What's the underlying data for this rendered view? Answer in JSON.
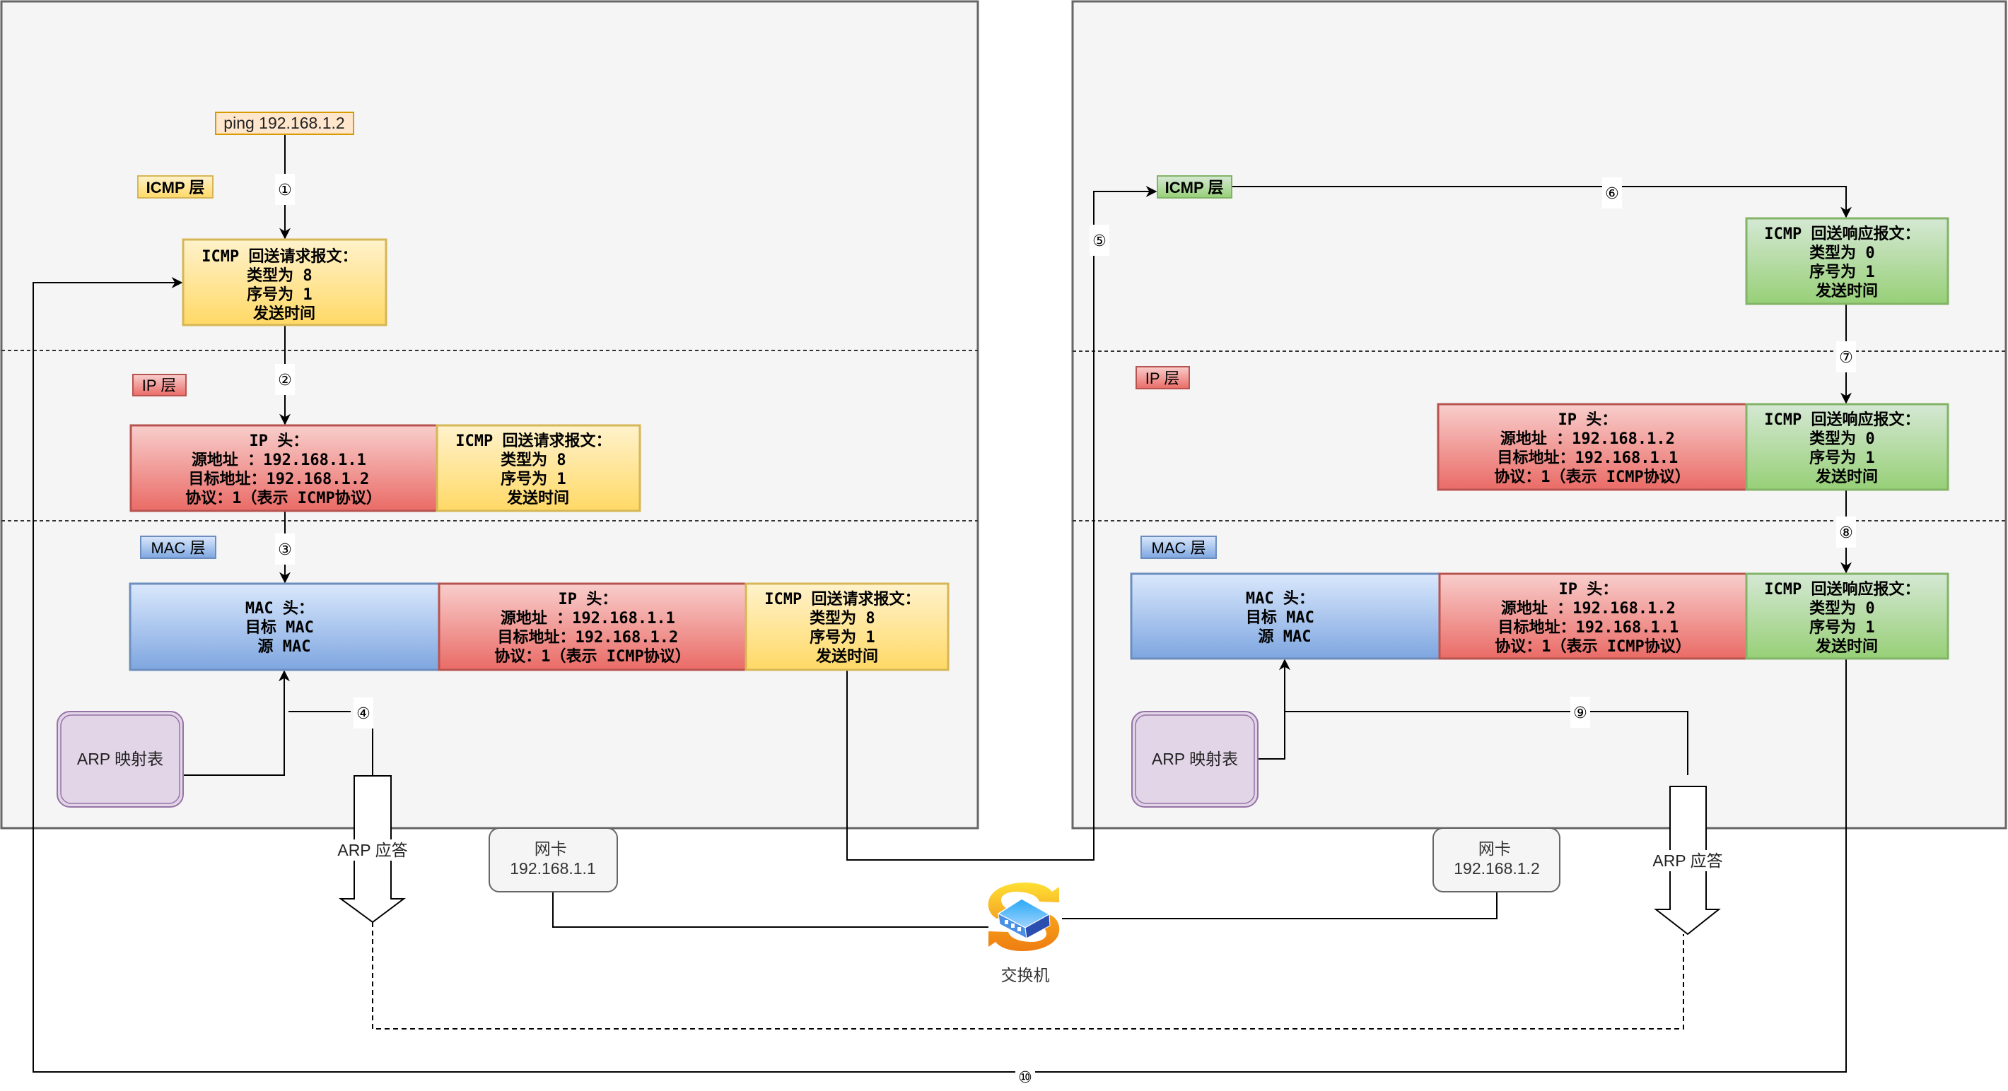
{
  "colors": {
    "icmp_request_fill_top": "#fff2cc",
    "icmp_request_fill_bottom": "#ffd966",
    "icmp_request_stroke": "#d6b656",
    "icmp_reply_fill_top": "#d5e8d4",
    "icmp_reply_fill_bottom": "#97d077",
    "icmp_reply_stroke": "#82b366",
    "ip_fill_top": "#f8cecc",
    "ip_fill_bottom": "#ea6b66",
    "ip_stroke": "#b85450",
    "mac_fill_top": "#dae8fc",
    "mac_fill_bottom": "#7ea6e0",
    "mac_stroke": "#6c8ebf",
    "arp_fill": "#e1d5e7",
    "arp_stroke": "#9673a6",
    "ping_fill": "#ffe6cc",
    "ping_stroke": "#d79b00"
  },
  "sender": {
    "command": "ping 192.168.1.2",
    "layers": {
      "icmp": "ICMP 层",
      "ip": "IP 层",
      "mac": "MAC 层"
    },
    "icmp_message": [
      "ICMP 回送请求报文：",
      "类型为 8",
      "序号为 1",
      "发送时间"
    ],
    "ip_header": [
      "IP 头：",
      "源地址  ：192.168.1.1",
      "目标地址：192.168.1.2",
      "协议：1（表示 ICMP协议）"
    ],
    "mac_header": [
      "MAC 头：",
      "目标 MAC",
      "源 MAC"
    ],
    "arp_table": "ARP 映射表",
    "arp_reply": "ARP 应答",
    "nic": [
      "网卡",
      "192.168.1.1"
    ]
  },
  "receiver": {
    "layers": {
      "icmp": "ICMP 层",
      "ip": "IP 层",
      "mac": "MAC 层"
    },
    "icmp_message": [
      "ICMP 回送响应报文：",
      "类型为 0",
      "序号为 1",
      "发送时间"
    ],
    "ip_header": [
      "IP 头：",
      "源地址  ：192.168.1.2",
      "目标地址：192.168.1.1",
      "协议：1（表示 ICMP协议）"
    ],
    "mac_header": [
      "MAC 头：",
      "目标 MAC",
      "源 MAC"
    ],
    "arp_table": "ARP 映射表",
    "arp_reply": "ARP 应答",
    "nic": [
      "网卡",
      "192.168.1.2"
    ]
  },
  "switch": {
    "label": "交换机",
    "icon": "network-switch-icon"
  },
  "steps": [
    "①",
    "②",
    "③",
    "④",
    "⑤",
    "⑥",
    "⑦",
    "⑧",
    "⑨",
    "⑩"
  ]
}
